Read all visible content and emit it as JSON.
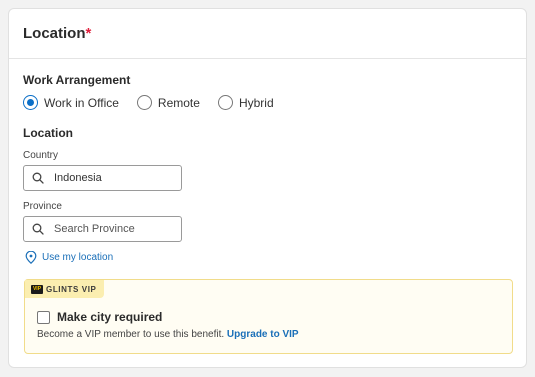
{
  "section": {
    "title": "Location",
    "required_mark": "*"
  },
  "work_arrangement": {
    "label": "Work Arrangement",
    "options": [
      {
        "label": "Work in Office",
        "selected": true
      },
      {
        "label": "Remote",
        "selected": false
      },
      {
        "label": "Hybrid",
        "selected": false
      }
    ]
  },
  "location": {
    "label": "Location",
    "country": {
      "label": "Country",
      "value": "Indonesia"
    },
    "province": {
      "label": "Province",
      "placeholder": "Search Province"
    },
    "use_my_location": "Use my location"
  },
  "vip": {
    "badge_logo_text": "VIP",
    "badge_label": "GLINTS VIP",
    "checkbox_label": "Make city required",
    "checkbox_checked": false,
    "note": "Become a VIP member to use this benefit.",
    "upgrade_label": "Upgrade to VIP"
  },
  "colors": {
    "accent": "#0b6fc7",
    "link": "#1a6fb8",
    "required": "#e01e3c",
    "vip_border": "#f1dc8a",
    "vip_badge_bg": "#fbeeb0"
  }
}
